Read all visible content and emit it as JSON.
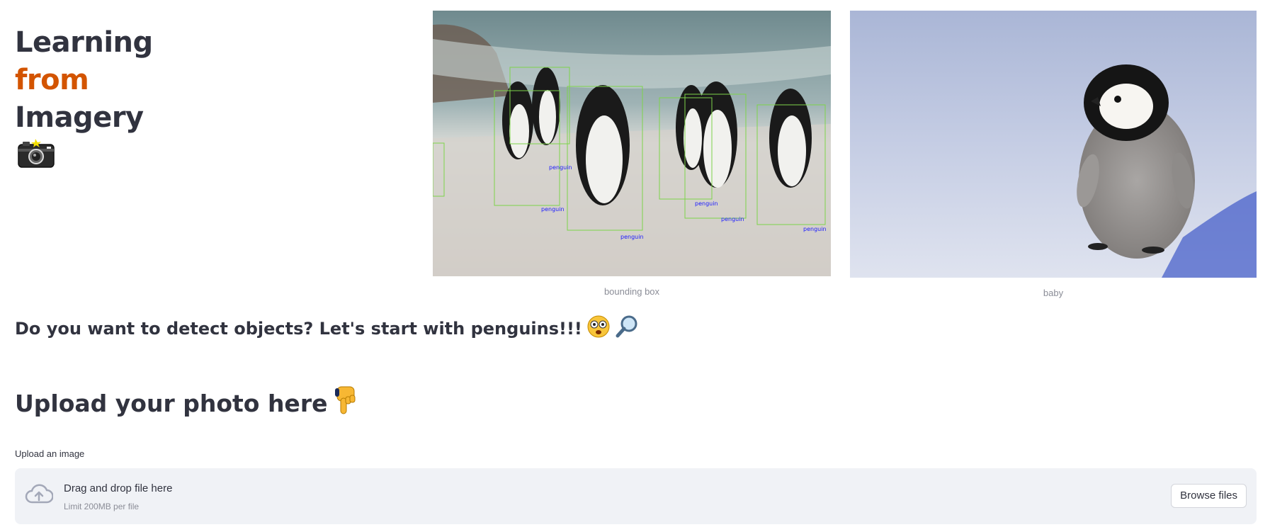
{
  "title": {
    "line1": "Learning",
    "line2": "from",
    "line3": "Imagery",
    "icon": "camera-with-flash-icon"
  },
  "images": [
    {
      "caption": "bounding box",
      "box_label": "penguin",
      "box_color": "#7dd44a",
      "label_color": "#1a1aff"
    },
    {
      "caption": "baby"
    }
  ],
  "prompt": {
    "text": "Do you want to detect objects? Let's start with penguins!!!",
    "icons": [
      "shocked-face-icon",
      "magnifying-glass-icon"
    ]
  },
  "upload_heading": {
    "text": "Upload your photo here",
    "icon": "pointing-down-hand-icon"
  },
  "uploader": {
    "label": "Upload an image",
    "drop_text": "Drag and drop file here",
    "limit_text": "Limit 200MB per file",
    "button_label": "Browse files",
    "icon": "cloud-upload-icon"
  },
  "colors": {
    "text": "#31333f",
    "accent": "#d35400",
    "dropzone_bg": "#f0f2f6",
    "muted": "#8b8d97"
  }
}
